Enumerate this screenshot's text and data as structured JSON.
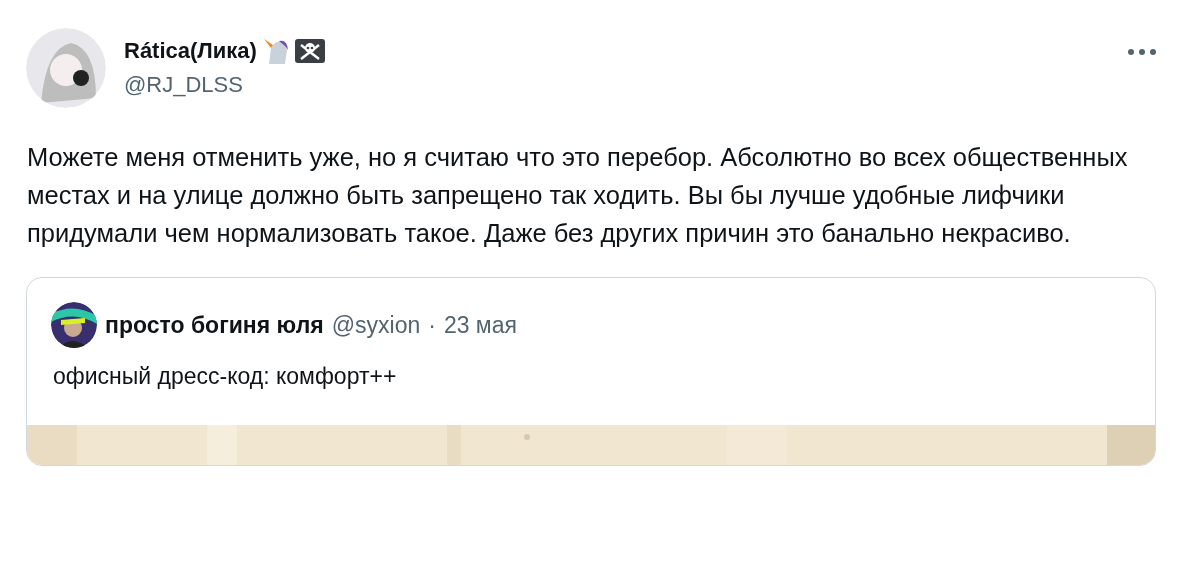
{
  "tweet": {
    "author": {
      "name": "Rática(Лика)",
      "handle": "@RJ_DLSS"
    },
    "text": "Можете меня отменить уже, но я считаю что это перебор. Абсолютно во всех общественных местах и на улице должно быть запрещено так ходить. Вы бы лучше удобные лифчики придумали чем нормализовать такое. Даже без других причин это банально некрасиво.",
    "quote": {
      "author": {
        "name": "просто богиня юля",
        "handle": "@syxion"
      },
      "separator": "·",
      "date": "23 мая",
      "text": "офисный дресс-код: комфорт++"
    }
  }
}
